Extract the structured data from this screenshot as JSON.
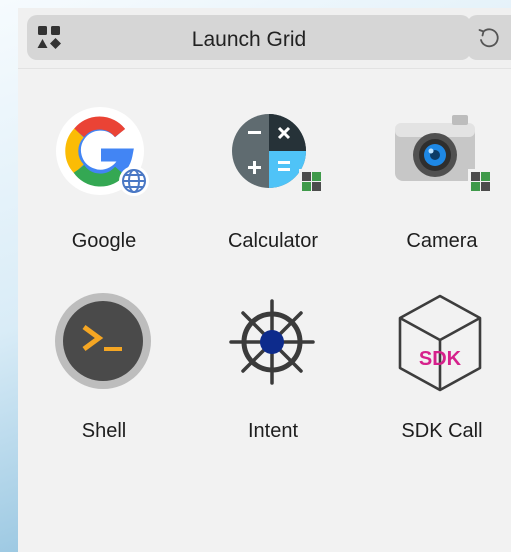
{
  "header": {
    "title": "Launch Grid",
    "menu_icon": "apps-grid-icon",
    "refresh_icon": "refresh-icon"
  },
  "apps": [
    {
      "label": "Google",
      "icon": "google-icon"
    },
    {
      "label": "Calculator",
      "icon": "calculator-icon"
    },
    {
      "label": "Camera",
      "icon": "camera-icon"
    },
    {
      "label": "Shell",
      "icon": "terminal-icon"
    },
    {
      "label": "Intent",
      "icon": "ships-wheel-icon"
    },
    {
      "label": "SDK Call",
      "icon": "sdk-cube-icon",
      "badge_text": "SDK"
    }
  ],
  "colors": {
    "google_blue": "#4285f4",
    "google_red": "#ea4335",
    "google_yellow": "#fbbc05",
    "google_green": "#34a853",
    "sdk_magenta": "#d6218c",
    "terminal_orange": "#f5a623",
    "intent_navy": "#0d2b8c"
  }
}
